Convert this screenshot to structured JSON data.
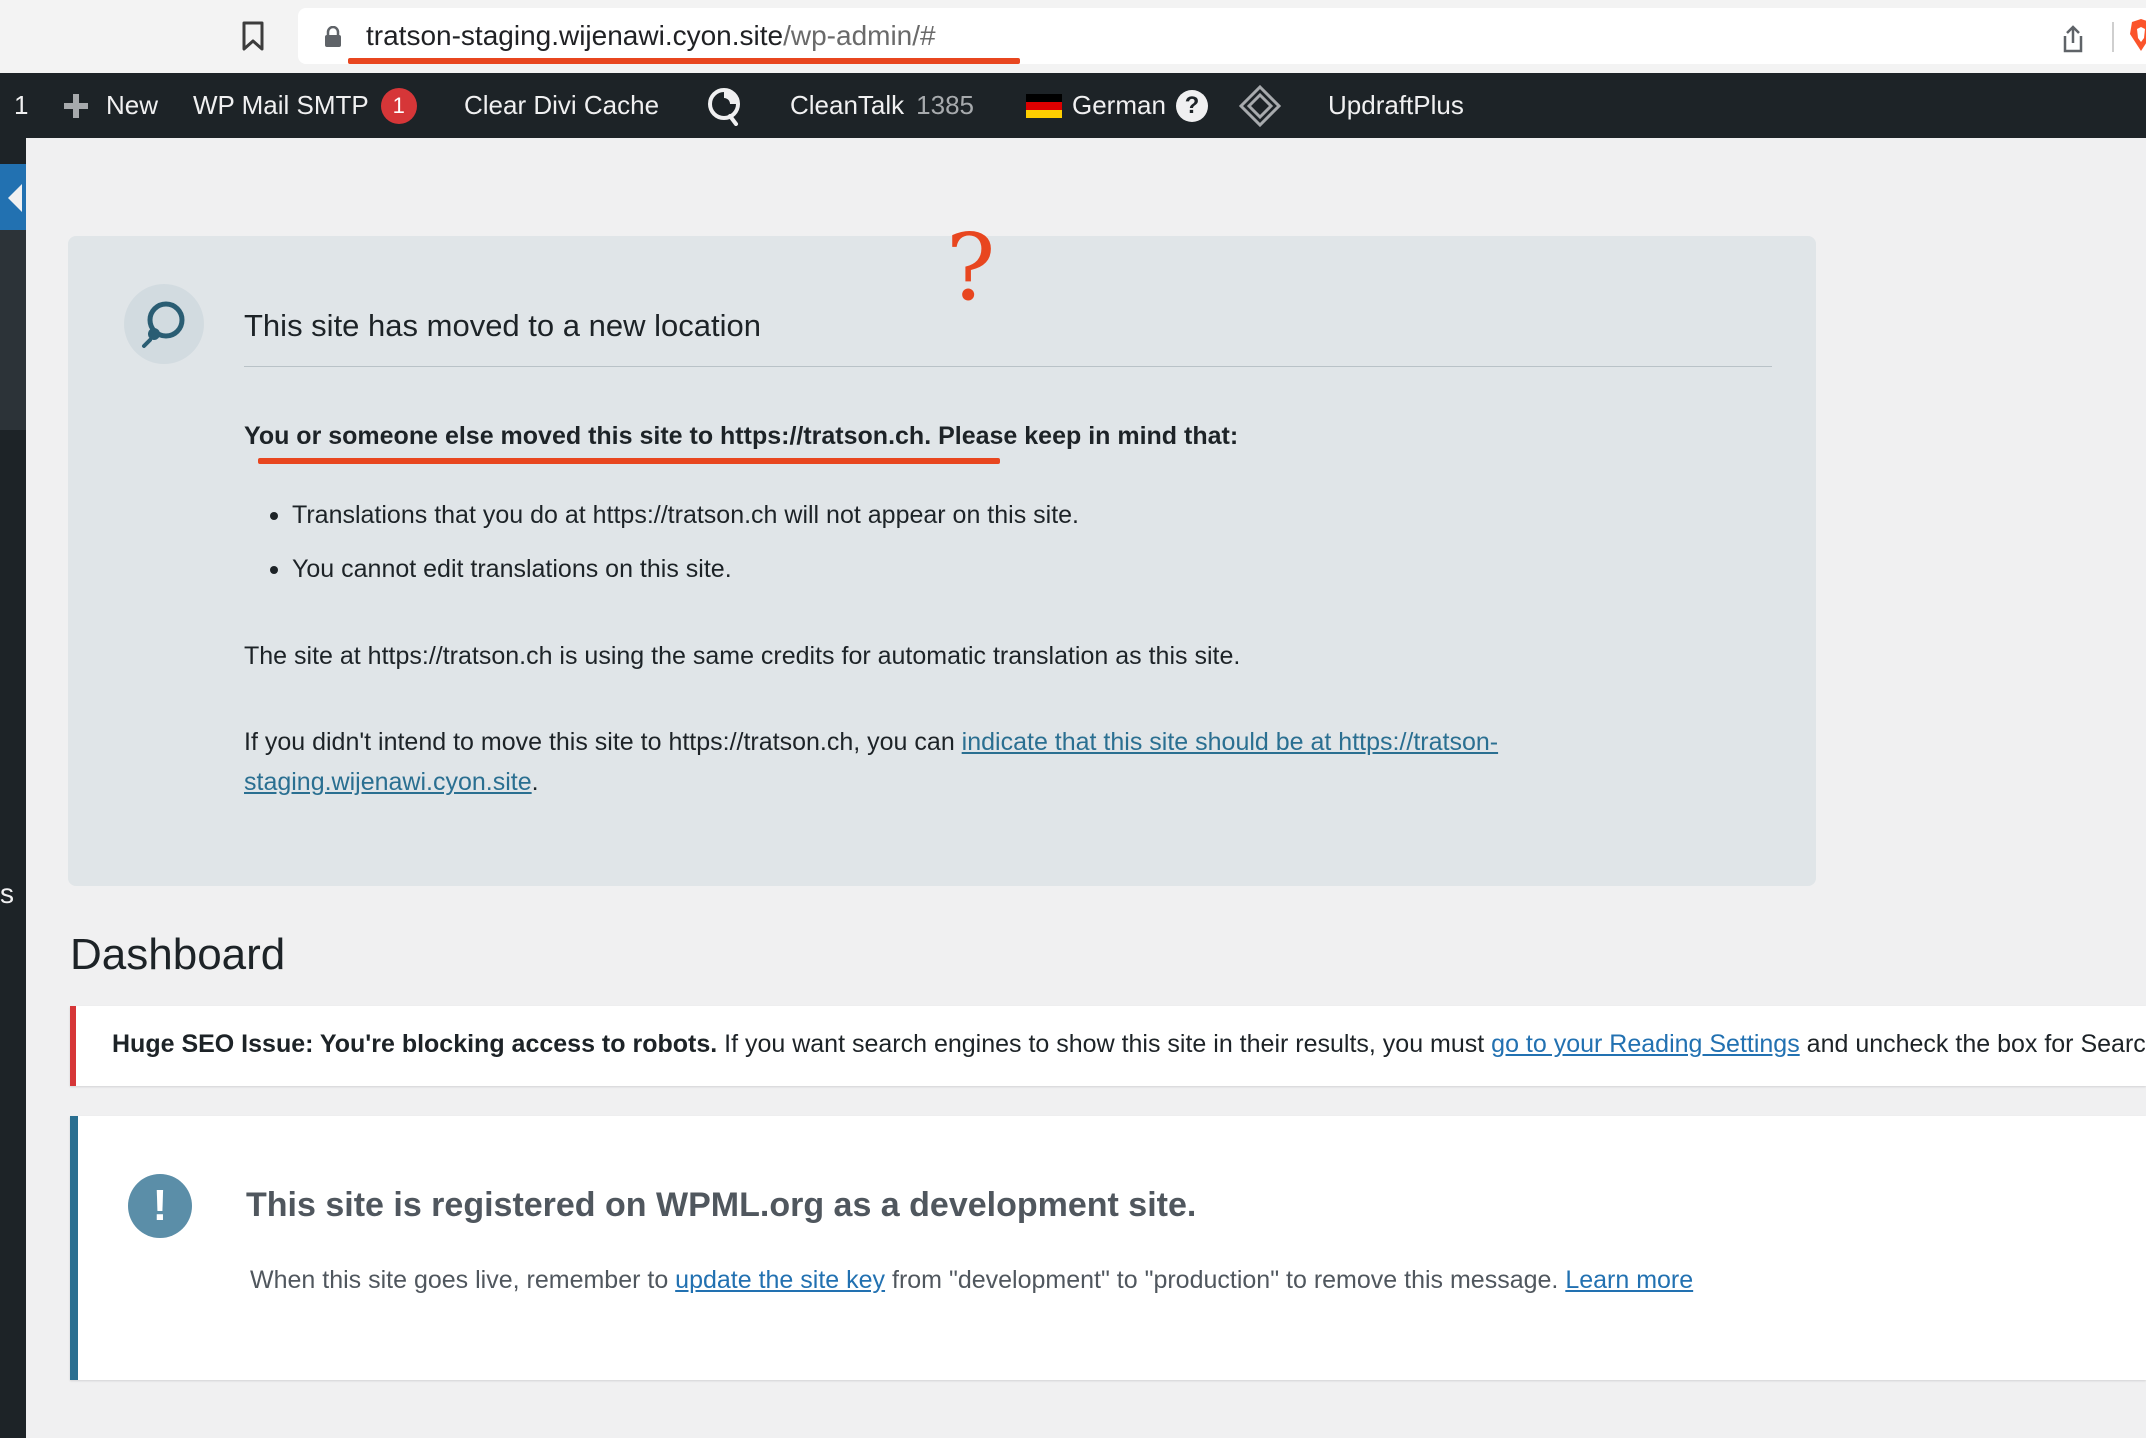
{
  "browser": {
    "url_host": "tratson-staging.wijenawi.cyon.site",
    "url_path": "/wp-admin/#"
  },
  "admin_bar": {
    "count_fragment": "1",
    "new_label": "New",
    "wp_mail_smtp_label": "WP Mail SMTP",
    "wp_mail_smtp_badge": "1",
    "clear_divi_label": "Clear Divi Cache",
    "cleantalk_label": "CleanTalk",
    "cleantalk_count": "1385",
    "language_label": "German",
    "help_glyph": "?",
    "updraft_label": "UpdraftPlus"
  },
  "admin_menu": {
    "fragment": "s"
  },
  "moved_notice": {
    "annotation_mark": "?",
    "title": "This site has moved to a new location",
    "lead": "You or someone else moved this site to https://tratson.ch. Please keep in mind that:",
    "bullets": [
      "Translations that you do at https://tratson.ch will not appear on this site.",
      "You cannot edit translations on this site."
    ],
    "credits_text": "The site at https://tratson.ch is using the same credits for automatic translation as this site.",
    "intend_prefix": "If you didn't intend to move this site to https://tratson.ch, you can ",
    "intend_link": "indicate that this site should be at https://tratson-staging.wijenawi.cyon.site",
    "intend_suffix": "."
  },
  "dashboard": {
    "title": "Dashboard"
  },
  "seo_notice": {
    "bold": "Huge SEO Issue: You're blocking access to robots.",
    "text": " If you want search engines to show this site in their results, you must ",
    "link": "go to your Reading Settings",
    "suffix": " and uncheck the box for Search Engine Visibility."
  },
  "dev_notice": {
    "icon_glyph": "!",
    "title": "This site is registered on WPML.org as a development site.",
    "text_prefix": "When this site goes live, remember to ",
    "link_update": "update the site key",
    "text_middle": " from \"development\" to \"production\" to remove this message. ",
    "link_learn": "Learn more"
  },
  "colors": {
    "admin_bar_bg": "#1d2327",
    "annotation_red": "#e8461f",
    "notice_error": "#d63638",
    "wpml_accent": "#2a6f91",
    "link_blue": "#2271b1"
  },
  "icons": [
    "bookmark-icon",
    "lock-icon",
    "share-icon",
    "brave-icon",
    "plus-icon",
    "divi-cache-icon",
    "wpml-language-icon",
    "wpml-logo-icon",
    "exclamation-icon"
  ]
}
